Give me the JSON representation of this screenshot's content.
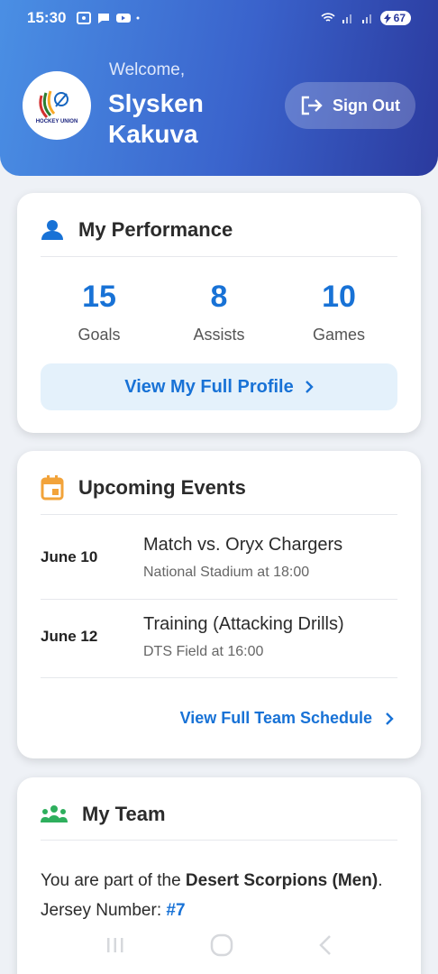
{
  "status": {
    "time": "15:30",
    "battery": "67"
  },
  "header": {
    "logo_text": "HOCKEY UNION",
    "welcome": "Welcome,",
    "user_name": "Slysken Kakuva",
    "sign_out": "Sign Out"
  },
  "performance": {
    "title": "My Performance",
    "stats": [
      {
        "value": "15",
        "label": "Goals"
      },
      {
        "value": "8",
        "label": "Assists"
      },
      {
        "value": "10",
        "label": "Games"
      }
    ],
    "profile_button": "View My Full Profile"
  },
  "events": {
    "title": "Upcoming Events",
    "items": [
      {
        "date": "June 10",
        "title": "Match vs. Oryx Chargers",
        "location": "National Stadium at 18:00"
      },
      {
        "date": "June 12",
        "title": "Training (Attacking Drills)",
        "location": "DTS Field at 16:00"
      }
    ],
    "schedule_link": "View Full Team Schedule"
  },
  "team": {
    "title": "My Team",
    "prefix": "You are part of the ",
    "team_name": "Desert Scorpions (Men)",
    "suffix": ".",
    "jersey_label": "Jersey Number: ",
    "jersey_number": "#7"
  },
  "colors": {
    "accent": "#1872d6",
    "header_start": "#4a8fe4",
    "header_end": "#2b3a9e",
    "calendar_icon": "#f2a33a",
    "team_icon": "#2eaf5d"
  }
}
